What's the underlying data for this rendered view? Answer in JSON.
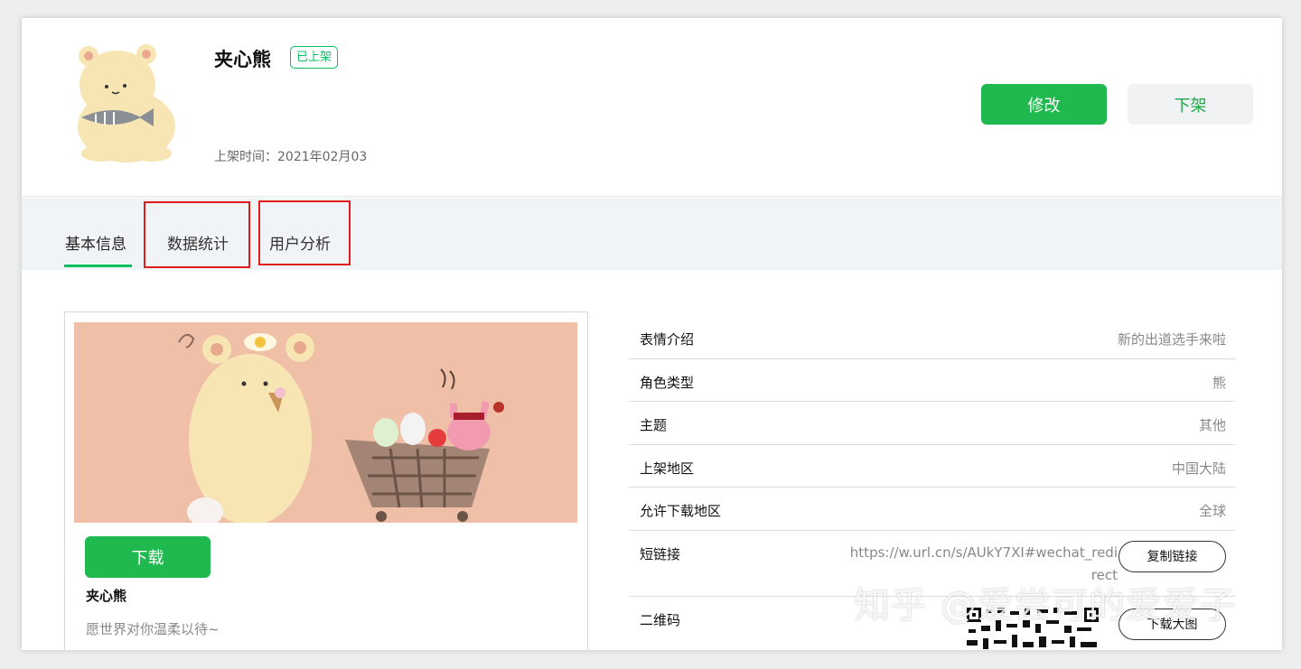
{
  "header": {
    "title": "夹心熊",
    "status_badge": "已上架",
    "publish_time": "上架时间：2021年02月03",
    "edit_button": "修改",
    "delist_button": "下架"
  },
  "tabs": [
    {
      "label": "基本信息",
      "active": true
    },
    {
      "label": "数据统计",
      "active": false
    },
    {
      "label": "用户分析",
      "active": false
    }
  ],
  "preview": {
    "download_button": "下载",
    "name": "夹心熊",
    "description": "愿世界对你温柔以待~"
  },
  "info": {
    "rows": [
      {
        "label": "表情介绍",
        "value": "新的出道选手来啦"
      },
      {
        "label": "角色类型",
        "value": "熊"
      },
      {
        "label": "主题",
        "value": "其他"
      },
      {
        "label": "上架地区",
        "value": "中国大陆"
      },
      {
        "label": "允许下载地区",
        "value": "全球"
      }
    ],
    "short_link": {
      "label": "短链接",
      "value": "https://w.url.cn/s/AUkY7XI#wechat_redirect",
      "copy_button": "复制链接"
    },
    "qrcode": {
      "label": "二维码",
      "save_button": "下载大图"
    }
  },
  "watermark": "知乎 @爱尝可的爱爱子",
  "colors": {
    "brand_green": "#07c160",
    "button_green": "#1fb94f",
    "highlight_red": "#e21b1b",
    "banner_bg": "#efbfa8"
  }
}
